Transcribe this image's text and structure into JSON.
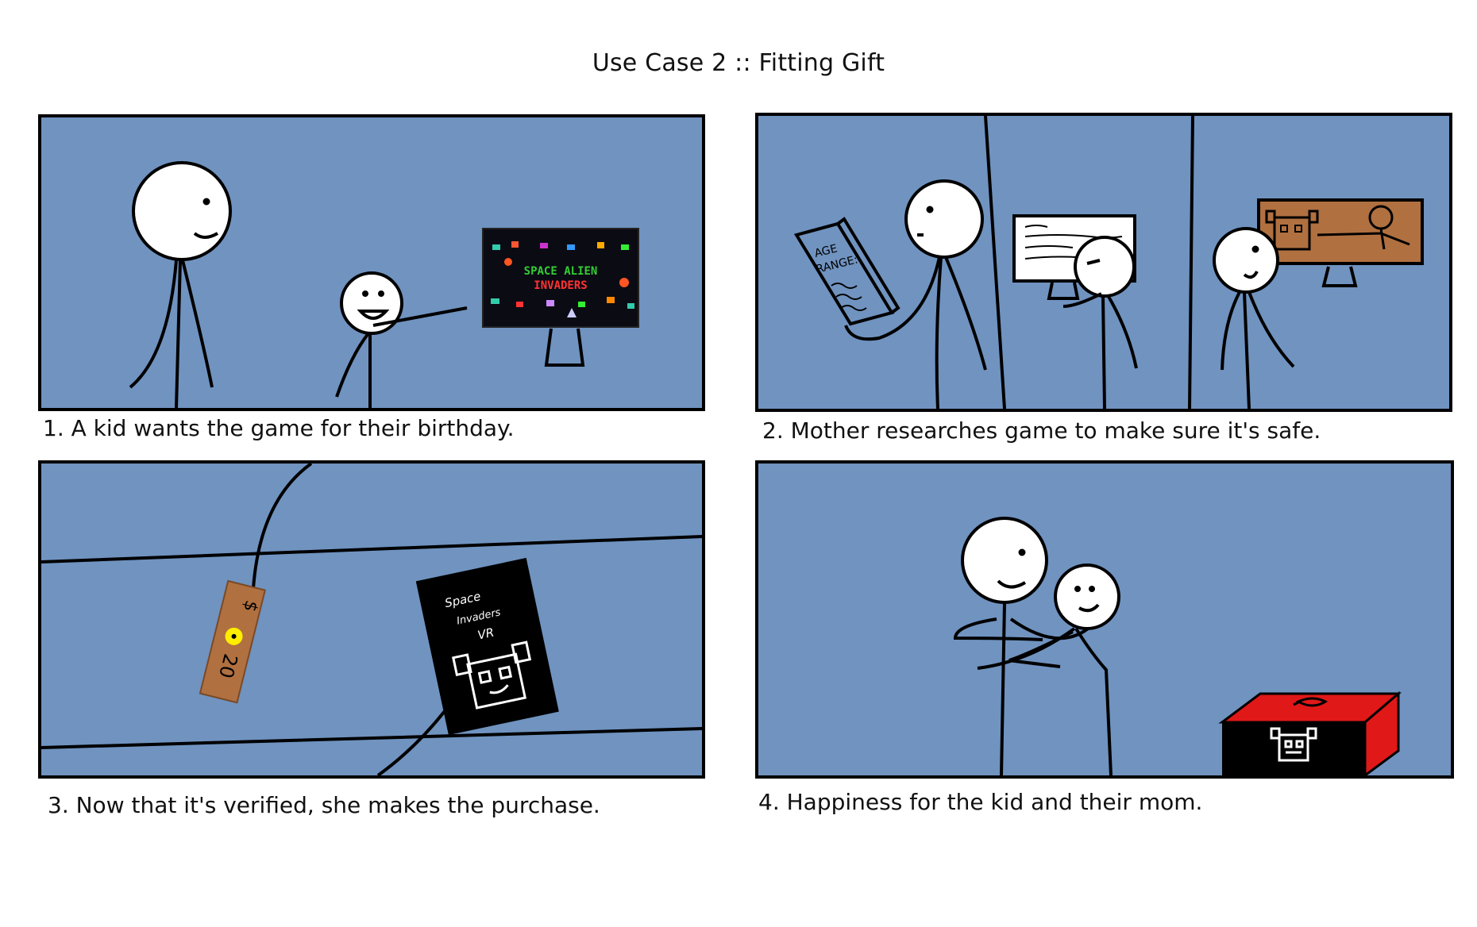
{
  "title": "Use Case 2 :: Fitting Gift",
  "colors": {
    "panel_bg": "#7093c0",
    "outline": "#000000",
    "screen_bg": "#0b0b14",
    "accent_green": "#33cc33",
    "accent_red": "#ff3333",
    "price_tag": "#b07040",
    "brown_screen": "#b07040",
    "gift_red": "#e01818",
    "coin_yellow": "#ffee00"
  },
  "panels": [
    {
      "caption": "1. A kid wants the game for their birthday.",
      "screen_line1": "SPACE ALIEN",
      "screen_line2": "INVADERS"
    },
    {
      "caption": "2. Mother researches game to make sure it's safe.",
      "book_line1": "AGE",
      "book_line2": "RANGE:"
    },
    {
      "caption": "3. Now that it's verified, she makes the purchase.",
      "tag_amount": "20",
      "tag_currency": "$",
      "box_line1": "Space",
      "box_line2": "Invaders",
      "box_line3": "VR"
    },
    {
      "caption": "4. Happiness for the kid and their mom."
    }
  ]
}
